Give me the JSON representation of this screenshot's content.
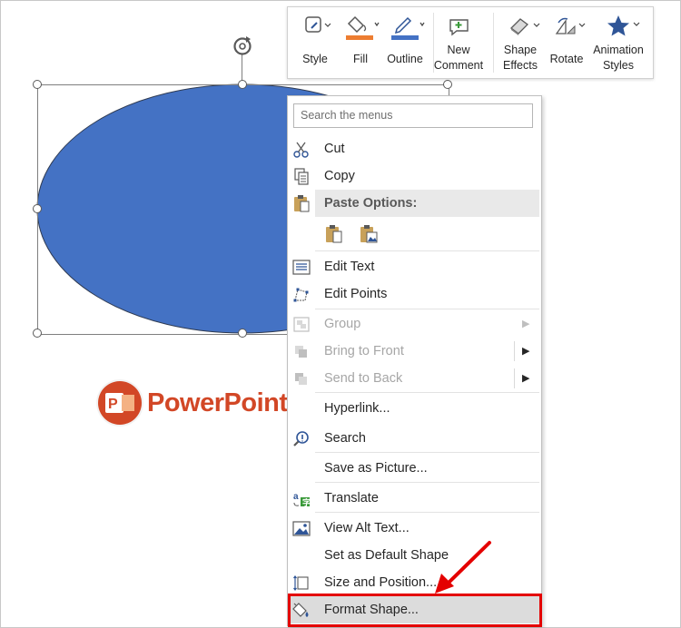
{
  "toolbar": {
    "style": "Style",
    "fill": "Fill",
    "outline": "Outline",
    "new_comment_1": "New",
    "new_comment_2": "Comment",
    "shape_effects_1": "Shape",
    "shape_effects_2": "Effects",
    "rotate": "Rotate",
    "animation_styles_1": "Animation",
    "animation_styles_2": "Styles"
  },
  "menu": {
    "search_placeholder": "Search the menus",
    "cut": "Cut",
    "copy": "Copy",
    "paste_options": "Paste Options:",
    "edit_text": "Edit Text",
    "edit_points": "Edit Points",
    "group": "Group",
    "bring_to_front": "Bring to Front",
    "send_to_back": "Send to Back",
    "hyperlink": "Hyperlink...",
    "search": "Search",
    "save_as_picture": "Save as Picture...",
    "translate": "Translate",
    "view_alt_text": "View Alt Text...",
    "set_default_shape": "Set as Default Shape",
    "size_and_position": "Size and Position...",
    "format_shape": "Format Shape..."
  },
  "watermark": {
    "text": "PowerPoint.com.vn"
  },
  "colors": {
    "shape_fill": "#4472c4",
    "shape_stroke": "#2f3b52",
    "fill_swatch": "#ed7d31",
    "outline_swatch": "#4472c4",
    "highlight_box": "#e40000",
    "brand": "#d24726"
  }
}
